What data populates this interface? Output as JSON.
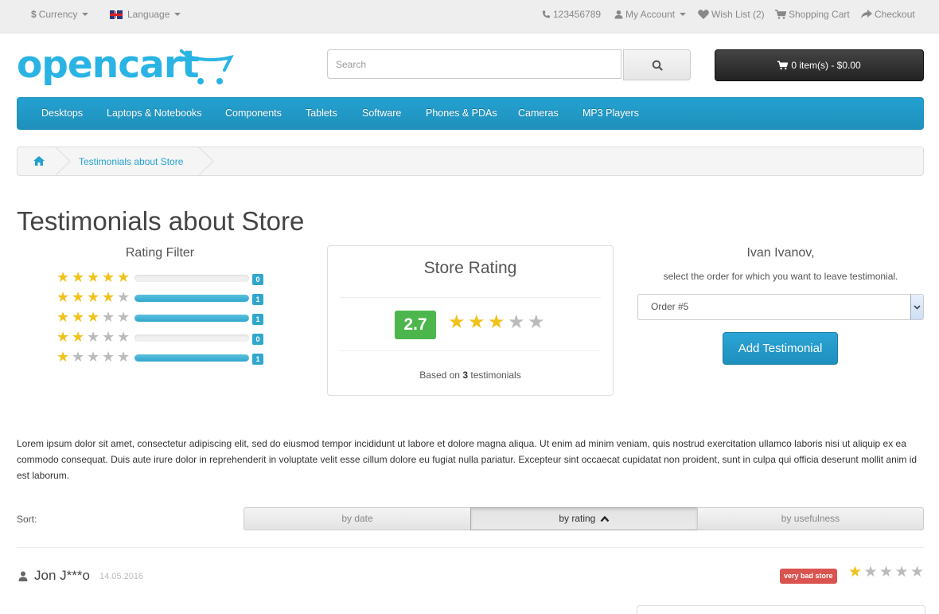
{
  "topbar": {
    "currency": "Currency",
    "currency_symbol": "$",
    "language": "Language",
    "phone": "123456789",
    "account": "My Account",
    "wishlist": "Wish List (2)",
    "cart": "Shopping Cart",
    "checkout": "Checkout"
  },
  "header": {
    "logo_text": "opencart",
    "search_placeholder": "Search",
    "cart_label": "0 item(s) - $0.00"
  },
  "menu": [
    "Desktops",
    "Laptops & Notebooks",
    "Components",
    "Tablets",
    "Software",
    "Phones & PDAs",
    "Cameras",
    "MP3 Players"
  ],
  "breadcrumb": {
    "current": "Testimonials about Store"
  },
  "page_title": "Testimonials about Store",
  "rating_filter": {
    "title": "Rating Filter",
    "rows": [
      {
        "stars": 5,
        "count": "0",
        "fill": 0
      },
      {
        "stars": 4,
        "count": "1",
        "fill": 1
      },
      {
        "stars": 3,
        "count": "1",
        "fill": 1
      },
      {
        "stars": 2,
        "count": "0",
        "fill": 0
      },
      {
        "stars": 1,
        "count": "1",
        "fill": 1
      }
    ]
  },
  "store_rating": {
    "title": "Store Rating",
    "score": "2.7",
    "stars": 3,
    "based_prefix": "Based on",
    "based_count": "3",
    "based_suffix": "testimonials"
  },
  "leave": {
    "user": "Ivan Ivanov,",
    "hint": "select the order for which you want to leave testimonial.",
    "order_selected": "Order #5",
    "add_button": "Add Testimonial"
  },
  "description": "Lorem ipsum dolor sit amet, consectetur adipiscing elit, sed do eiusmod tempor incididunt ut labore et dolore magna aliqua. Ut enim ad minim veniam, quis nostrud exercitation ullamco laboris nisi ut aliquip ex ea commodo consequat. Duis aute irure dolor in reprehenderit in voluptate velit esse cillum dolore eu fugiat nulla pariatur. Excepteur sint occaecat cupidatat non proident, sunt in culpa qui officia deserunt mollit anim id est laborum.",
  "sort": {
    "label": "Sort:",
    "by_date": "by date",
    "by_rating": "by rating",
    "by_usefulness": "by usefulness",
    "active": "by_rating"
  },
  "review": {
    "author": "Jon J***o",
    "date": "14.05.2016",
    "badge": "very bad store",
    "stars": 1
  },
  "colors": {
    "brand": "#29b4e3",
    "menu": "#229ac8",
    "star": "#f0c21b",
    "score": "#4cb64c",
    "danger": "#d9534f"
  }
}
